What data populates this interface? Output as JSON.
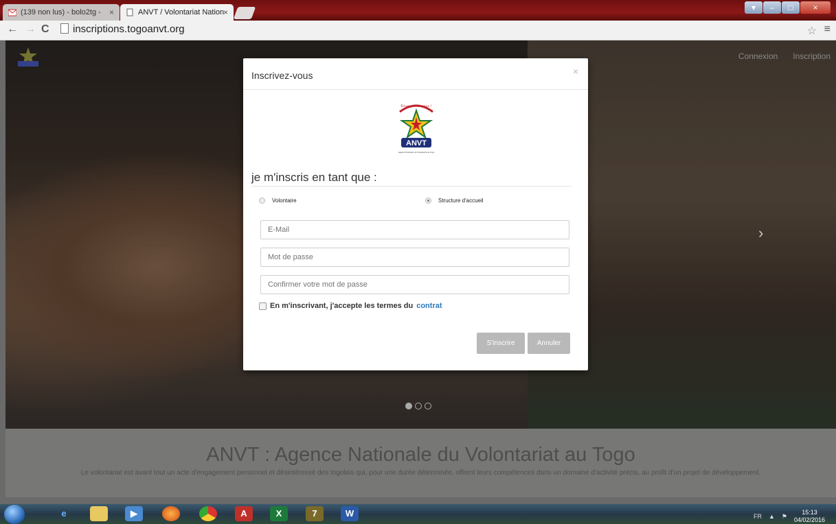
{
  "browser": {
    "tabs": [
      {
        "label": "(139 non lus) - bolo2tg - ",
        "favicon": "gmail-icon"
      },
      {
        "label": "ANVT / Volontariat Nation",
        "favicon": "page-icon"
      }
    ],
    "address": "inscriptions.togoanvt.org"
  },
  "site": {
    "nav": {
      "connexion": "Connexion",
      "inscription": "Inscription"
    },
    "logo_text": "ANVT",
    "footer_title": "ANVT : Agence Nationale du Volontariat au Togo",
    "footer_text": "Le volontariat est avant tout un acte d'engagement personnel et désintéressé des togolais qui, pour une durée déterminée, offrent leurs compétences dans un domaine d'activité précis, au profit d'un projet de développement."
  },
  "modal": {
    "title": "Inscrivez-vous",
    "close": "×",
    "logo": {
      "banner": "Engageons-nous !",
      "acronym": "ANVT",
      "subtitle": "Agence Nationale du Volontariat au Togo"
    },
    "section_label": "je m'inscris en tant que :",
    "radio_options": [
      {
        "label": "Volontaire",
        "selected": false
      },
      {
        "label": "Structure d'accueil",
        "selected": true
      }
    ],
    "email_placeholder": "E-Mail",
    "password_placeholder": "Mot de passe",
    "confirm_placeholder": "Confirmer votre mot de passe",
    "terms_text": "En m'inscrivant, j'accepte les termes du",
    "terms_link": "contrat",
    "submit_label": "S'inscrire",
    "cancel_label": "Annuler"
  },
  "taskbar": {
    "lang": "FR",
    "time": "15:13",
    "date": "04/02/2016"
  }
}
